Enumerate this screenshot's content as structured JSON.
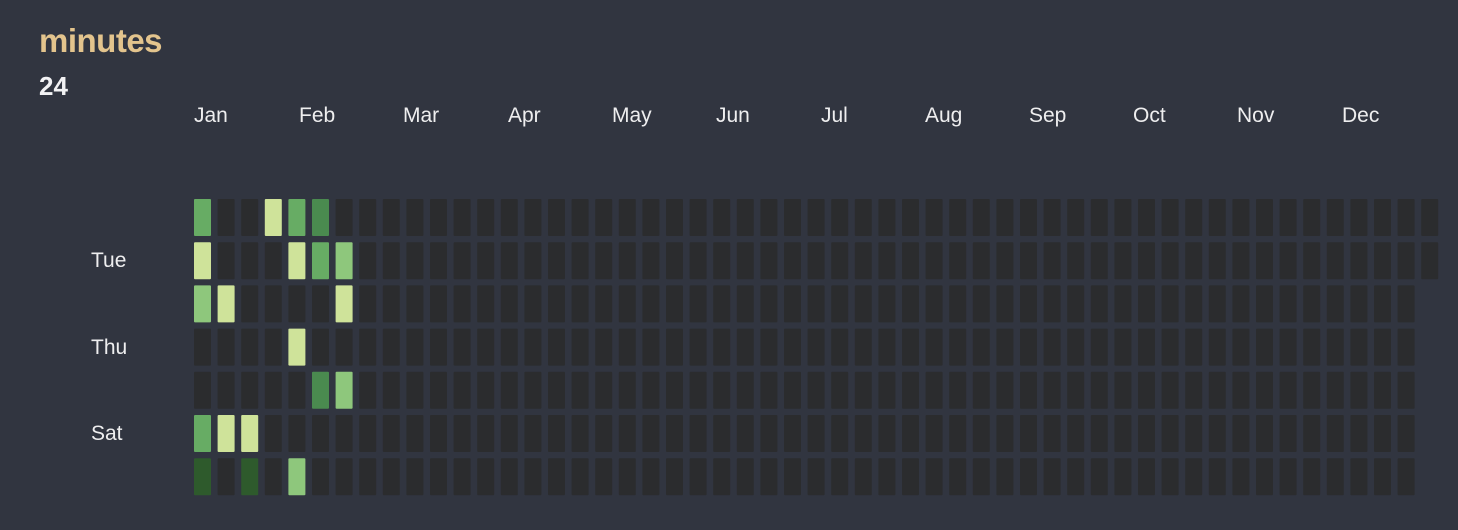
{
  "header": {
    "title": "minutes",
    "total": "24"
  },
  "colors": {
    "background": "#313540",
    "empty": "#2b2c2e",
    "level1": "#cfe39a",
    "level2": "#8ec77c",
    "level3": "#67ac64",
    "level4": "#4a8a4f",
    "level5": "#2e5a2c",
    "title": "#e3c48d"
  },
  "chart_data": {
    "type": "heatmap",
    "title": "minutes",
    "total": 24,
    "months": [
      "Jan",
      "Feb",
      "Mar",
      "Apr",
      "May",
      "Jun",
      "Jul",
      "Aug",
      "Sep",
      "Oct",
      "Nov",
      "Dec"
    ],
    "row_labels": [
      "",
      "Tue",
      "",
      "Thu",
      "",
      "Sat",
      ""
    ],
    "weeks": 53,
    "active_cells": [
      {
        "week": 0,
        "row": 0,
        "level": 3
      },
      {
        "week": 0,
        "row": 1,
        "level": 1
      },
      {
        "week": 0,
        "row": 2,
        "level": 2
      },
      {
        "week": 0,
        "row": 5,
        "level": 3
      },
      {
        "week": 0,
        "row": 6,
        "level": 5
      },
      {
        "week": 1,
        "row": 2,
        "level": 1
      },
      {
        "week": 1,
        "row": 5,
        "level": 1
      },
      {
        "week": 2,
        "row": 5,
        "level": 1
      },
      {
        "week": 2,
        "row": 6,
        "level": 5
      },
      {
        "week": 3,
        "row": 0,
        "level": 1
      },
      {
        "week": 4,
        "row": 0,
        "level": 3
      },
      {
        "week": 4,
        "row": 1,
        "level": 1
      },
      {
        "week": 4,
        "row": 3,
        "level": 1
      },
      {
        "week": 4,
        "row": 6,
        "level": 2
      },
      {
        "week": 5,
        "row": 0,
        "level": 4
      },
      {
        "week": 5,
        "row": 1,
        "level": 3
      },
      {
        "week": 5,
        "row": 4,
        "level": 4
      },
      {
        "week": 6,
        "row": 1,
        "level": 2
      },
      {
        "week": 6,
        "row": 2,
        "level": 1
      },
      {
        "week": 6,
        "row": 4,
        "level": 2
      }
    ]
  }
}
